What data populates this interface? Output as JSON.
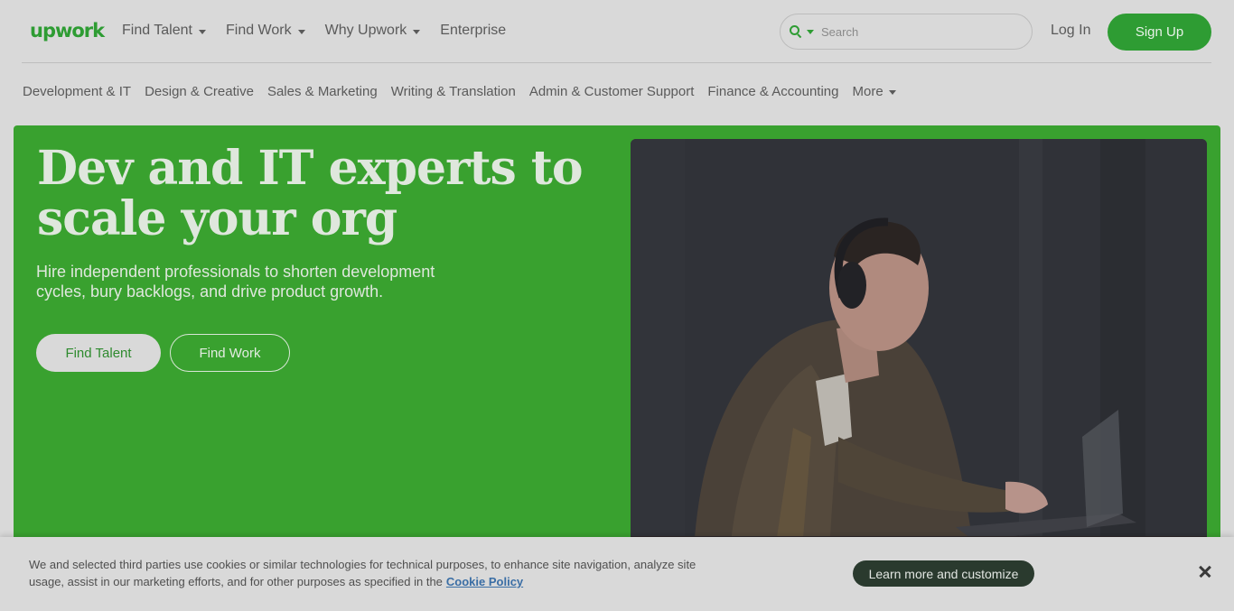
{
  "header": {
    "logo": "upwork",
    "nav": [
      {
        "label": "Find Talent",
        "dropdown": true
      },
      {
        "label": "Find Work",
        "dropdown": true
      },
      {
        "label": "Why Upwork",
        "dropdown": true
      },
      {
        "label": "Enterprise",
        "dropdown": false
      }
    ],
    "search_placeholder": "Search",
    "login": "Log In",
    "signup": "Sign Up"
  },
  "categories": [
    "Development & IT",
    "Design & Creative",
    "Sales & Marketing",
    "Writing & Translation",
    "Admin & Customer Support",
    "Finance & Accounting",
    "More"
  ],
  "hero": {
    "title": "Dev and IT experts to scale your org",
    "subtitle": "Hire independent professionals to shorten development cycles, bury backlogs, and drive product growth.",
    "primary_button": "Find Talent",
    "secondary_button": "Find Work"
  },
  "cookie": {
    "text": "We and selected third parties use cookies or similar technologies for technical purposes, to enhance site navigation, analyze site usage, assist in our marketing efforts, and for other purposes as specified in the",
    "link": "Cookie Policy",
    "button": "Learn more and customize"
  },
  "colors": {
    "brand_green": "#39a12f",
    "dark_button": "#2a3a2e"
  }
}
